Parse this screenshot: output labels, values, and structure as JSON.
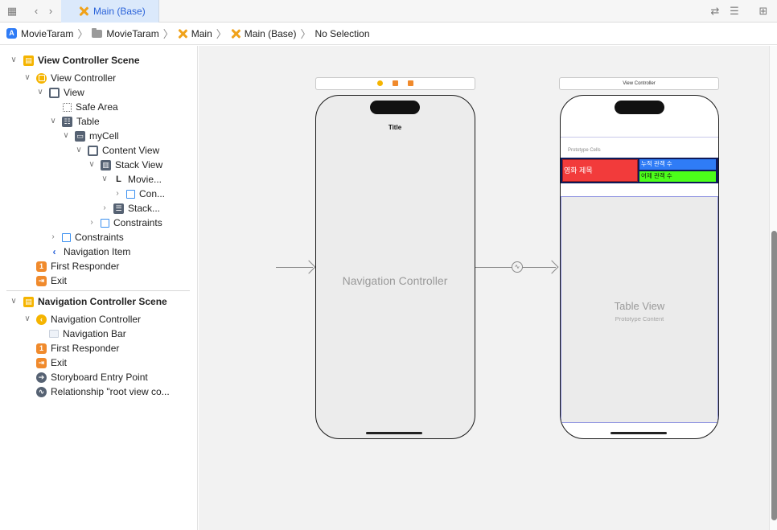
{
  "tabbar": {
    "active_tab": "Main (Base)"
  },
  "jumpbar": {
    "crumbs": [
      "MovieTaram",
      "MovieTaram",
      "Main",
      "Main (Base)",
      "No Selection"
    ]
  },
  "outline": {
    "scene1": {
      "title": "View Controller Scene",
      "view_controller": "View Controller",
      "view": "View",
      "safe_area": "Safe Area",
      "table": "Table",
      "cell": "myCell",
      "content_view": "Content View",
      "stack_view": "Stack View",
      "movie_label": "Movie...",
      "con": "Con...",
      "stack2": "Stack...",
      "constraints_inner": "Constraints",
      "constraints": "Constraints",
      "navigation_item": "Navigation Item",
      "first_responder": "First Responder",
      "exit": "Exit"
    },
    "scene2": {
      "title": "Navigation Controller Scene",
      "navigation_controller": "Navigation Controller",
      "navigation_bar": "Navigation Bar",
      "first_responder": "First Responder",
      "exit": "Exit",
      "entry_point": "Storyboard Entry Point",
      "relationship": "Relationship \"root view co..."
    }
  },
  "canvas": {
    "nav_scene": {
      "title_label": "Title",
      "center_label": "Navigation Controller"
    },
    "vc_scene": {
      "bar_label": "View Controller",
      "prototype_cells": "Prototype Cells",
      "cell_title": "영화 제목",
      "cell_cumulative": "누적 관객 수",
      "cell_yesterday": "어제 관객 수",
      "table_view": "Table View",
      "prototype_content": "Prototype Content"
    },
    "colors": {
      "cell_red": "#f23b3b",
      "cell_blue": "#2f7cf6",
      "cell_green": "#4cff1a",
      "accent": "#2b63d9"
    }
  }
}
